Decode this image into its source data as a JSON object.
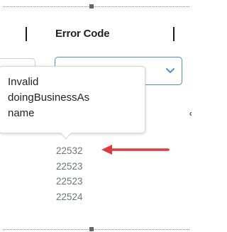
{
  "header": {
    "error_code_label": "Error Code"
  },
  "filter": {
    "selected_value": ""
  },
  "tooltip": {
    "lines": [
      "Invalid",
      "doingBusinessAs",
      "name"
    ]
  },
  "codes": [
    "22532",
    "22523",
    "22523",
    "22524"
  ],
  "colors": {
    "accent": "#4a8fd9",
    "arrow": "#e03a3a",
    "code_text": "#6f7380"
  },
  "icons": {
    "chevron": "chevron-down-icon",
    "annotation_arrow": "red-arrow-icon"
  }
}
